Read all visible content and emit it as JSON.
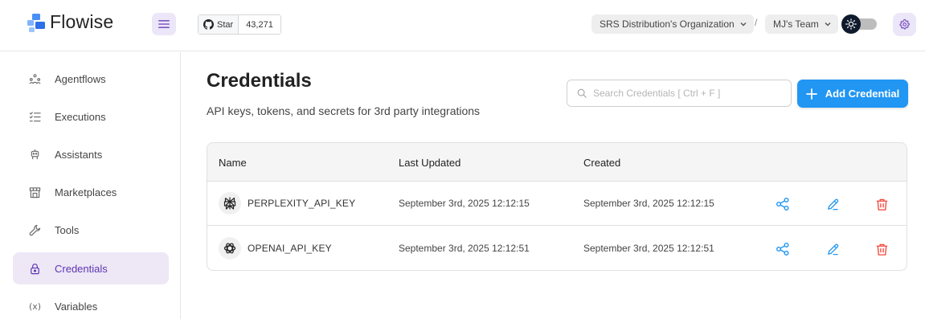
{
  "app": {
    "name": "Flowise"
  },
  "github": {
    "star_label": "Star",
    "stars": "43,271"
  },
  "header": {
    "organization": "SRS Distribution's Organization",
    "separator": "/",
    "team": "MJ's Team"
  },
  "sidebar": {
    "items": [
      {
        "label": "Agentflows",
        "icon": "agentflows-icon",
        "active": false
      },
      {
        "label": "Executions",
        "icon": "executions-icon",
        "active": false
      },
      {
        "label": "Assistants",
        "icon": "robot-icon",
        "active": false
      },
      {
        "label": "Marketplaces",
        "icon": "store-icon",
        "active": false
      },
      {
        "label": "Tools",
        "icon": "tool-icon",
        "active": false
      },
      {
        "label": "Credentials",
        "icon": "lock-icon",
        "active": true
      },
      {
        "label": "Variables",
        "icon": "variable-icon",
        "active": false
      }
    ]
  },
  "page": {
    "title": "Credentials",
    "subtitle": "API keys, tokens, and secrets for 3rd party integrations",
    "search_placeholder": "Search Credentials [ Ctrl + F ]",
    "add_button": "Add Credential"
  },
  "table": {
    "columns": [
      "Name",
      "Last Updated",
      "Created"
    ],
    "rows": [
      {
        "name": "PERPLEXITY_API_KEY",
        "icon": "perplexity-icon",
        "last_updated": "September 3rd, 2025 12:12:15",
        "created": "September 3rd, 2025 12:12:15"
      },
      {
        "name": "OPENAI_API_KEY",
        "icon": "openai-icon",
        "last_updated": "September 3rd, 2025 12:12:51",
        "created": "September 3rd, 2025 12:12:51"
      }
    ]
  },
  "colors": {
    "accent": "#2196f3",
    "active_nav_bg": "#ede7f6",
    "active_nav_text": "#5e35b1",
    "delete": "#f44336"
  }
}
